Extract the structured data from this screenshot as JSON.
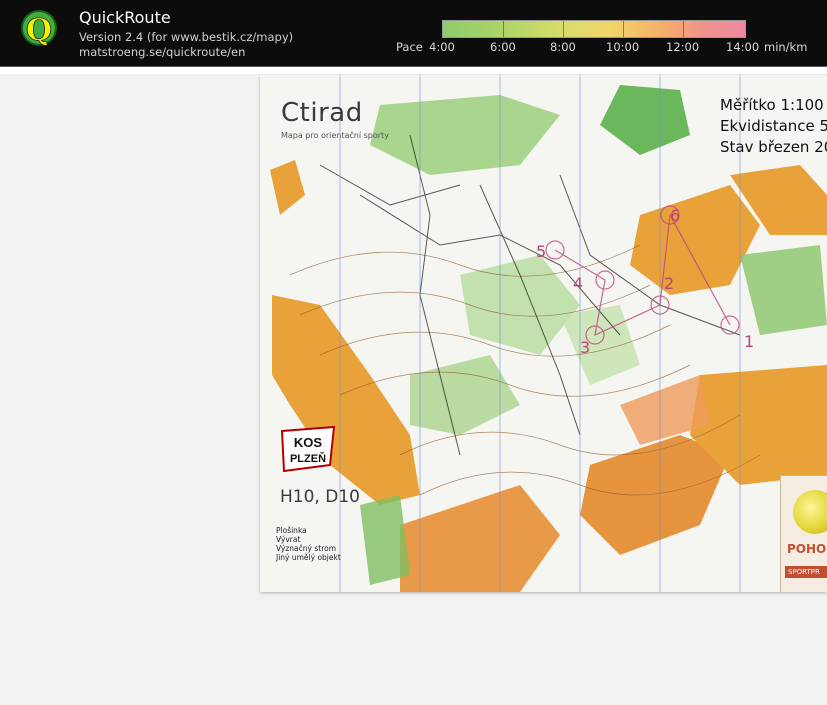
{
  "app": {
    "title": "QuickRoute",
    "version": "Version 2.4  (for www.bestik.cz/mapy)",
    "site": "matstroeng.se/quickroute/en"
  },
  "pace": {
    "label": "Pace",
    "ticks": [
      "4:00",
      "6:00",
      "8:00",
      "10:00",
      "12:00",
      "14:00"
    ],
    "unit": "min/km"
  },
  "map": {
    "title": "Ctirad",
    "subtitle": "Mapa pro orientační sporty",
    "scale_lines": "Měřítko 1:100\nEkvidistance 5\nStav březen 20",
    "course": "H10, D10",
    "legend_items": [
      "Plošinka",
      "Vývrat",
      "Význačný strom",
      "Jiný umělý objekt"
    ],
    "club": "KOS\nPLZEŇ",
    "control_numbers": [
      "5",
      "4",
      "3",
      "6",
      "2",
      "1"
    ],
    "sponsor_text": "POHO",
    "sponsor_subtext": "SPORTPR"
  }
}
